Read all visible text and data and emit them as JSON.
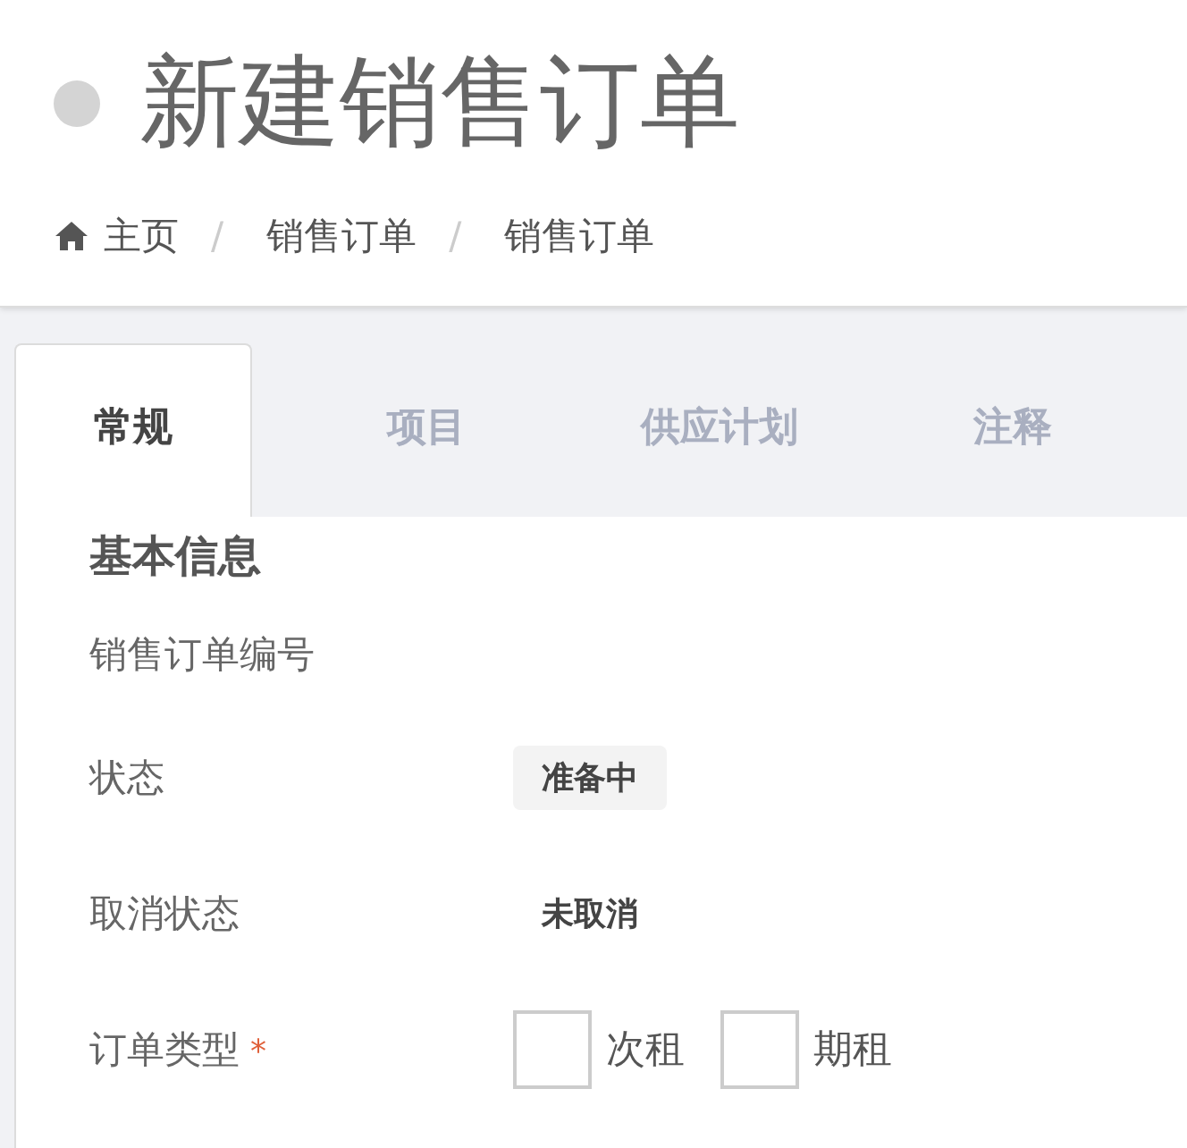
{
  "page_title": "新建销售订单",
  "breadcrumb": [
    "主页",
    "销售订单",
    "销售订单"
  ],
  "breadcrumb_separator": "/",
  "tabs": [
    {
      "label": "常规",
      "selected": true
    },
    {
      "label": "项目",
      "selected": false
    },
    {
      "label": "供应计划",
      "selected": false
    },
    {
      "label": "注释",
      "selected": false
    }
  ],
  "section_title": "基本信息",
  "fields": [
    {
      "kind": "empty",
      "label": "销售订单编号"
    },
    {
      "kind": "badge",
      "label": "状态",
      "value": "准备中"
    },
    {
      "kind": "text",
      "label": "取消状态",
      "value": "未取消"
    },
    {
      "kind": "checkboxes",
      "label": "订单类型",
      "required_mark": "*",
      "options": [
        {
          "label": "次租",
          "checked": false
        },
        {
          "label": "期租",
          "checked": false
        }
      ]
    }
  ]
}
